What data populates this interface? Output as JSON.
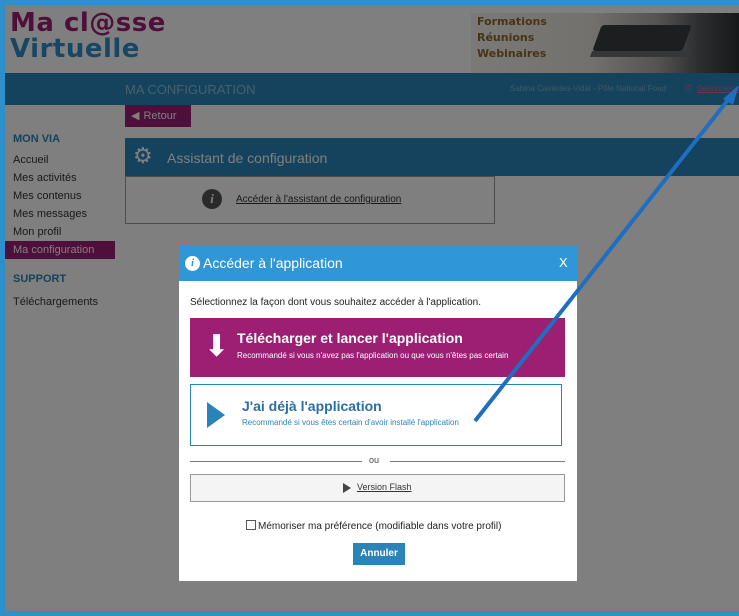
{
  "logo": {
    "line1": "Ma cl@sse",
    "line2": "Virtuelle"
  },
  "banner": {
    "items": [
      "Formations",
      "Réunions",
      "Webinaires"
    ]
  },
  "topbar": {
    "title": "MA CONFIGURATION",
    "user": "Sabina Caviedes-Vidal - Pôle National Foad",
    "logout": "Déconnexion"
  },
  "sidebar": {
    "section1": "MON VIA",
    "items1": [
      "Accueil",
      "Mes activités",
      "Mes contenus",
      "Mes messages",
      "Mon profil",
      "Ma configuration"
    ],
    "section2": "SUPPORT",
    "items2": [
      "Téléchargements"
    ],
    "active_item": "Ma configuration"
  },
  "main": {
    "back_label": "Retour",
    "wizard_title": "Assistant de configuration",
    "wizard_link": "Accéder à l'assistant de configuration"
  },
  "modal": {
    "title": "Accéder à l'application",
    "close": "X",
    "prompt": "Sélectionnez la façon dont vous souhaitez accéder à l'application.",
    "option1": {
      "title": "Télécharger et lancer l'application",
      "subtitle": "Recommandé si vous n'avez pas l'application ou que vous n'êtes pas certain"
    },
    "option2": {
      "title": "J'ai déjà l'application",
      "subtitle": "Recommandé si vous êtes certain d'avoir installé l'application"
    },
    "separator": "ou",
    "flash_label": "Version Flash",
    "remember_label": "Mémoriser ma préférence (modifiable dans votre profil)",
    "cancel_label": "Annuler"
  },
  "colors": {
    "accent_blue": "#2a84b8",
    "accent_purple": "#9c1f74",
    "frame_blue": "#2f8fca",
    "annotation_arrow": "#1e6fbf"
  }
}
